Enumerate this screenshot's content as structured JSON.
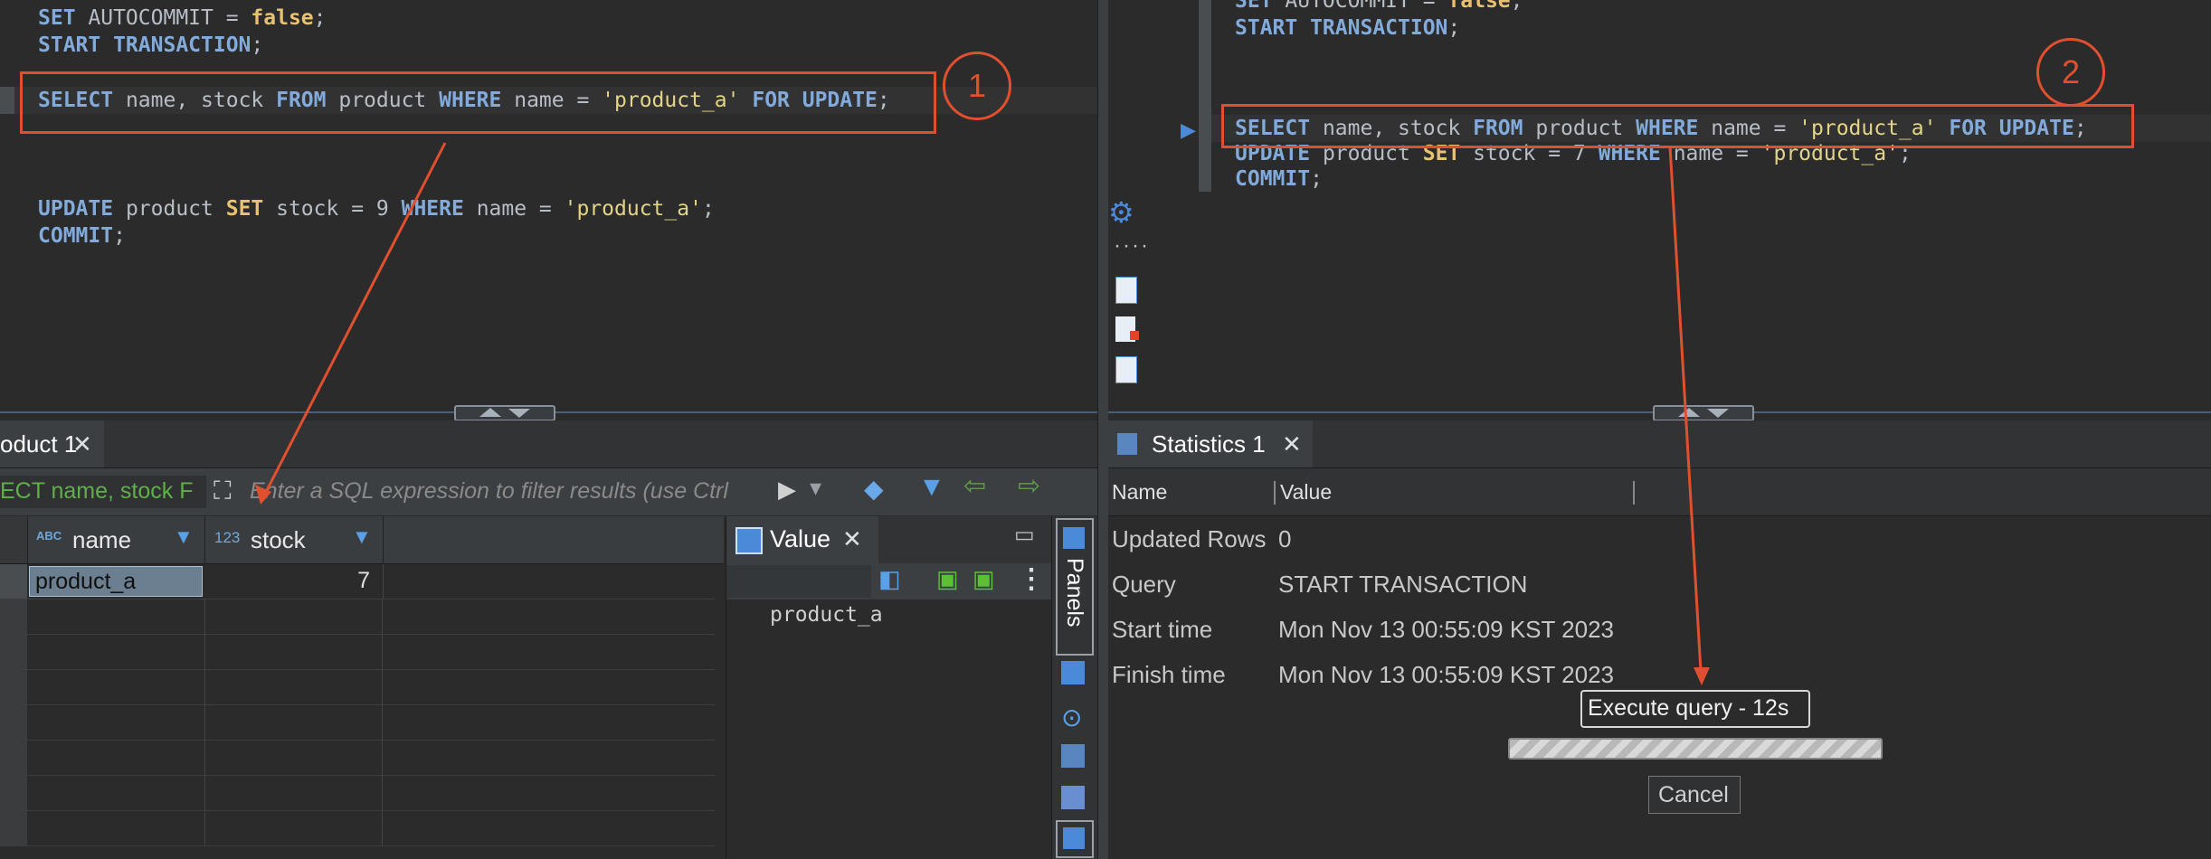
{
  "left_editor": {
    "lines": [
      {
        "parts": [
          [
            "kw",
            "SET"
          ],
          [
            "pl",
            " AUTOCOMMIT = "
          ],
          [
            "kw2",
            "false"
          ],
          [
            "pl",
            ";"
          ]
        ]
      },
      {
        "parts": [
          [
            "kw",
            "START TRANSACTION"
          ],
          [
            "pl",
            ";"
          ]
        ]
      },
      {
        "parts": [
          [
            "kw",
            "SELECT"
          ],
          [
            "pl",
            " name, stock "
          ],
          [
            "kw",
            "FROM"
          ],
          [
            "pl",
            " product "
          ],
          [
            "kw",
            "WHERE"
          ],
          [
            "pl",
            " name = "
          ],
          [
            "str",
            "'product_a'"
          ],
          [
            "pl",
            " "
          ],
          [
            "kw",
            "FOR UPDATE"
          ],
          [
            "pl",
            ";"
          ]
        ]
      },
      {
        "parts": [
          [
            "kw",
            "UPDATE"
          ],
          [
            "pl",
            " product "
          ],
          [
            "kw2",
            "SET"
          ],
          [
            "pl",
            " stock = 9 "
          ],
          [
            "kw",
            "WHERE"
          ],
          [
            "pl",
            " name = "
          ],
          [
            "str",
            "'product_a'"
          ],
          [
            "pl",
            ";"
          ]
        ]
      },
      {
        "parts": [
          [
            "kw",
            "COMMIT"
          ],
          [
            "pl",
            ";"
          ]
        ]
      }
    ],
    "annotation": "1"
  },
  "right_editor": {
    "lines": [
      {
        "parts": [
          [
            "kw",
            "SET"
          ],
          [
            "pl",
            " AUTOCOMMIT = "
          ],
          [
            "kw2",
            "false"
          ],
          [
            "pl",
            ";"
          ]
        ]
      },
      {
        "parts": [
          [
            "kw",
            "START TRANSACTION"
          ],
          [
            "pl",
            ";"
          ]
        ]
      },
      {
        "parts": [
          [
            "kw",
            "SELECT"
          ],
          [
            "pl",
            " name, stock "
          ],
          [
            "kw",
            "FROM"
          ],
          [
            "pl",
            " product "
          ],
          [
            "kw",
            "WHERE"
          ],
          [
            "pl",
            " name = "
          ],
          [
            "str",
            "'product_a'"
          ],
          [
            "pl",
            " "
          ],
          [
            "kw",
            "FOR UPDATE"
          ],
          [
            "pl",
            ";"
          ]
        ]
      },
      {
        "parts": [
          [
            "kw",
            "UPDATE"
          ],
          [
            "pl",
            " product "
          ],
          [
            "kw2",
            "SET"
          ],
          [
            "pl",
            " stock = 7 "
          ],
          [
            "kw",
            "WHERE"
          ],
          [
            "pl",
            " name = "
          ],
          [
            "str",
            "'product_a'"
          ],
          [
            "pl",
            ";"
          ]
        ]
      },
      {
        "parts": [
          [
            "kw",
            "COMMIT"
          ],
          [
            "pl",
            ";"
          ]
        ]
      }
    ],
    "annotation": "2"
  },
  "left_results": {
    "tab_label": "oduct 1",
    "filter_query": "ECT name, stock F",
    "filter_placeholder": "Enter a SQL expression to filter results (use Ctrl",
    "columns": [
      {
        "type": "ABC",
        "name": "name"
      },
      {
        "type": "123",
        "name": "stock"
      }
    ],
    "rows": [
      [
        "product_a",
        "7"
      ]
    ],
    "value_panel": {
      "title": "Value",
      "content": "product_a",
      "panels_label": "Panels"
    }
  },
  "right_results": {
    "tab_label": "Statistics 1",
    "columns": [
      "Name",
      "Value"
    ],
    "rows": [
      [
        "Updated Rows",
        "0"
      ],
      [
        "Query",
        "START TRANSACTION"
      ],
      [
        "Start time",
        "Mon Nov 13 00:55:09 KST 2023"
      ],
      [
        "Finish time",
        "Mon Nov 13 00:55:09 KST 2023"
      ]
    ],
    "progress": {
      "label": "Execute query - 12s",
      "cancel": "Cancel"
    }
  },
  "colors": {
    "annotation": "#e1502e",
    "keyword": "#82aadb",
    "keyword_alt": "#e8c171",
    "string": "#e3d48a"
  }
}
